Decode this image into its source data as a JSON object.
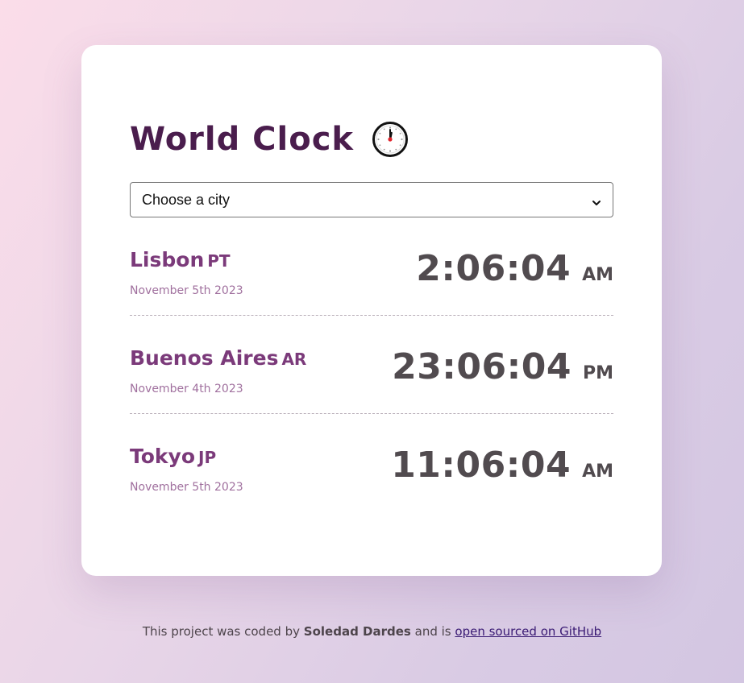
{
  "header": {
    "title": "World Clock",
    "icon": "clock-icon"
  },
  "city_select": {
    "selected": "Choose a city"
  },
  "cities": [
    {
      "name": "Lisbon",
      "code": "PT",
      "date": "November 5th 2023",
      "time": "2:06:04",
      "ampm": "AM"
    },
    {
      "name": "Buenos Aires",
      "code": "AR",
      "date": "November 4th 2023",
      "time": "23:06:04",
      "ampm": "PM"
    },
    {
      "name": "Tokyo",
      "code": "JP",
      "date": "November 5th 2023",
      "time": "11:06:04",
      "ampm": "AM"
    }
  ],
  "footer": {
    "prefix": "This project was coded by",
    "author": "Soledad Dardes",
    "middle": "and is",
    "link_text": "open sourced on GitHub"
  },
  "colors": {
    "title": "#4a1d4d",
    "city_name": "#7b3a7a",
    "date": "#a0709e",
    "time": "#514b4f",
    "link": "#3a1a74"
  }
}
